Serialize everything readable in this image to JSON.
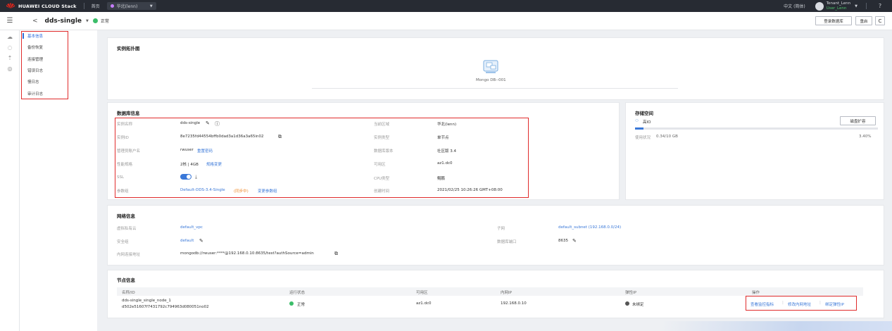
{
  "topbar": {
    "brand": "HUAWEI CLOUD Stack",
    "home": "首页",
    "region": "华北(lenn)",
    "language": "中文 (简体)",
    "tenant": "Tenant_Lenn",
    "user": "User_Lenn",
    "help": "?"
  },
  "header": {
    "back": "<",
    "instance_name": "dds-single",
    "status": "正常",
    "login_button": "登录数据库",
    "restart_button": "重启",
    "refresh_button": "C"
  },
  "sidebar": {
    "items": [
      {
        "label": "基本信息",
        "active": true
      },
      {
        "label": "备份恢复"
      },
      {
        "label": "连接管理"
      },
      {
        "label": "错误日志"
      },
      {
        "label": "慢日志"
      },
      {
        "label": "审计日志"
      }
    ]
  },
  "topology": {
    "title": "实例拓扑图",
    "node_label": "Mongo DB--001"
  },
  "dbinfo": {
    "title": "数据库信息",
    "left": [
      {
        "label": "实例名称",
        "value": "dds-single"
      },
      {
        "label": "实例ID",
        "value": "8e7235fd44554bffb0dad3a1d36a3a65in02"
      },
      {
        "label": "管理员账户名",
        "value": "rwuser",
        "link": "重置密码"
      },
      {
        "label": "性能规格",
        "value": "2核 | 4GB",
        "link": "规格变更"
      },
      {
        "label": "SSL",
        "value": ""
      },
      {
        "label": "参数组",
        "value": "Default-DDS-3.4-Single",
        "warn": "(同步中)",
        "link": "变更参数组"
      }
    ],
    "right": [
      {
        "label": "当前区域",
        "value": "华北(lenn)"
      },
      {
        "label": "实例类型",
        "value": "单节点"
      },
      {
        "label": "数据库版本",
        "value": "社区版 3.4"
      },
      {
        "label": "可用区",
        "value": "az1.dc0"
      },
      {
        "label": "CPU类型",
        "value": "鲲鹏"
      },
      {
        "label": "创建时间",
        "value": "2021/02/25 10:26:26 GMT+08:00"
      }
    ]
  },
  "storage": {
    "title": "存储空间",
    "type": "高IO",
    "expand_button": "磁盘扩容",
    "usage_label": "使用状况",
    "usage_value": "0.34/10 GB",
    "percent_text": "3.40%",
    "percent": 3.4
  },
  "network": {
    "title": "网络信息",
    "vpc_label": "虚拟私有云",
    "vpc_value": "default_vpc",
    "sg_label": "安全组",
    "sg_value": "default",
    "conn_label": "内网连接地址",
    "conn_value": "mongodb://rwuser:****@192.168.0.10:8635/test?authSource=admin",
    "subnet_label": "子网",
    "subnet_value": "default_subnet (192.168.0.0/24)",
    "port_label": "数据库端口",
    "port_value": "8635"
  },
  "nodes": {
    "title": "节点信息",
    "headers": [
      "名称/ID",
      "运行状态",
      "可用区",
      "内网IP",
      "弹性IP",
      "操作"
    ],
    "row": {
      "name": "dds-single_single_node_1",
      "id": "d502e51607f7431792c794963d080051no02",
      "status": "正常",
      "az": "az1.dc0",
      "ip": "192.168.0.10",
      "eip": "未绑定",
      "actions": [
        "查看监控指标",
        "修改内网地址",
        "绑定弹性IP"
      ]
    }
  },
  "colors": {
    "accent": "#3a78d8",
    "status_ok": "#3bbd69",
    "highlight": "#e02b2b",
    "warning": "#f08a2a"
  }
}
